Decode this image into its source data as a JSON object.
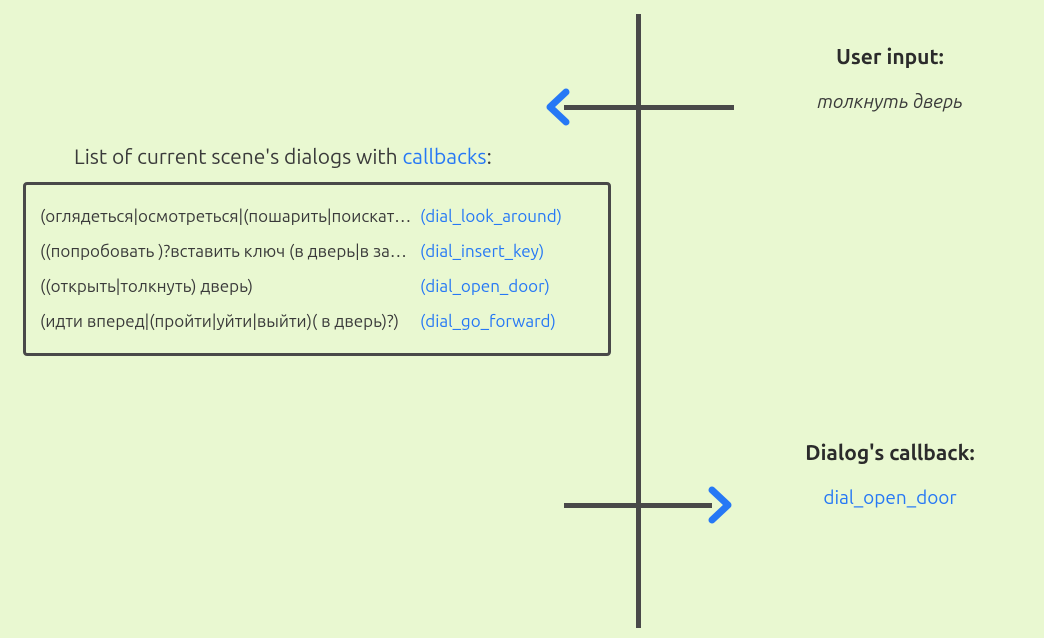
{
  "colors": {
    "background": "#E9F8D1",
    "text": "#3A3A3A",
    "line": "#494949",
    "accent": "#2678F5"
  },
  "right": {
    "input_heading": "User input:",
    "input_value": "толкнуть дверь",
    "callback_heading": "Dialog's callback:",
    "callback_value": "dial_open_door"
  },
  "left": {
    "heading_prefix": "List of current scene's dialogs with ",
    "heading_accent": "callbacks",
    "heading_suffix": ":"
  },
  "dialogs": [
    {
      "pattern": "(оглядеться|осмотреться|(пошарить|поискать|искать) что-то)",
      "callback": "(dial_look_around)"
    },
    {
      "pattern": "((попробовать )?вставить ключ (в дверь|в замок))",
      "callback": "(dial_insert_key)"
    },
    {
      "pattern": "((открыть|толкнуть) дверь)",
      "callback": "(dial_open_door)"
    },
    {
      "pattern": "(идти вперед|(пройти|уйти|выйти)( в дверь)?)",
      "callback": "(dial_go_forward)"
    }
  ]
}
